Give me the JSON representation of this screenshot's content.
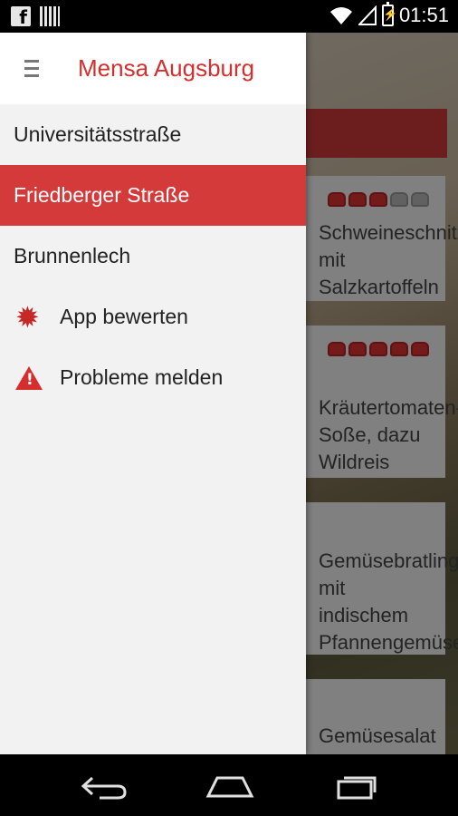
{
  "status_bar": {
    "time": "01:51",
    "notification_icons": [
      "facebook-icon",
      "barcode-icon"
    ],
    "system_icons": [
      "wifi-icon",
      "signal-icon",
      "battery-charging-icon"
    ]
  },
  "app": {
    "title": "Mensa Augsburg"
  },
  "drawer": {
    "locations": [
      {
        "label": "Universitätsstraße",
        "active": false
      },
      {
        "label": "Friedberger Straße",
        "active": true
      },
      {
        "label": "Brunnenlech",
        "active": false
      }
    ],
    "actions": [
      {
        "label": "App bewerten",
        "icon": "star-burst-icon"
      },
      {
        "label": "Probleme melden",
        "icon": "warning-icon"
      }
    ]
  },
  "background": {
    "cards": [
      {
        "title": "Schweineschnitzel mit Salzkartoffeln",
        "rating": 3
      },
      {
        "title": "Kräutertomaten-Soße, dazu Wildreis",
        "rating": 5
      },
      {
        "title": "Gemüsebratling mit indischem Pfannengemüse",
        "rating": null
      },
      {
        "title": "Gemüsesalat",
        "rating": null
      }
    ]
  },
  "colors": {
    "accent": "#d43a3a",
    "title_red": "#d42e2e",
    "drawer_bg": "#f2f2f2"
  }
}
